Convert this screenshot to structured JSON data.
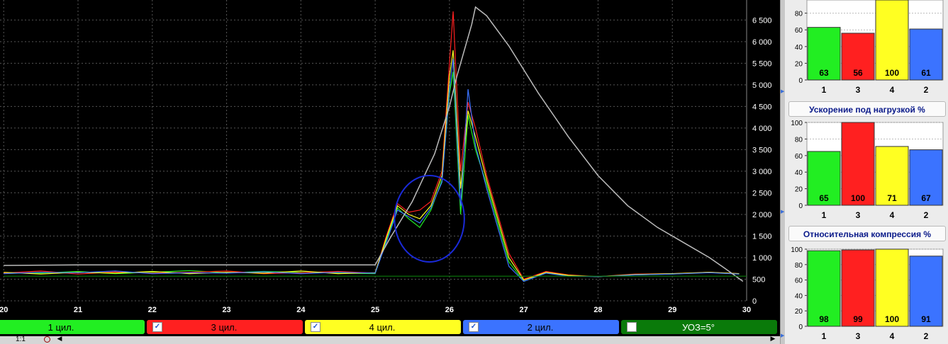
{
  "colors": {
    "background": "#000000",
    "grid": "#555555",
    "cyl1": "#22ee22",
    "cyl3": "#ff2020",
    "cyl4": "#ffff22",
    "cyl2": "#3b73ff",
    "rpm": "#bbbbbb",
    "uoz": "#0a7a0a",
    "annotation": "#1a2ad8"
  },
  "legend": [
    {
      "label": "1 цил.",
      "checked": true,
      "color": "#22ee22"
    },
    {
      "label": "3 цил.",
      "checked": true,
      "color": "#ff2020"
    },
    {
      "label": "4 цил.",
      "checked": true,
      "color": "#ffff22"
    },
    {
      "label": "2 цил.",
      "checked": true,
      "color": "#3b73ff"
    },
    {
      "label": "УОЗ=5°",
      "checked": false,
      "color": "#0a7a0a"
    }
  ],
  "status_bar": {
    "scale": "1:1"
  },
  "chart_data": [
    {
      "type": "line",
      "x_ticks": [
        "20",
        "21",
        "22",
        "23",
        "24",
        "25",
        "26",
        "27",
        "28",
        "29",
        "30"
      ],
      "y_ticks": [
        "0",
        "500",
        "1 000",
        "1 500",
        "2 000",
        "2 500",
        "3 000",
        "3 500",
        "4 000",
        "4 500",
        "5 000",
        "5 500",
        "6 000",
        "6 500"
      ],
      "xlim": [
        19.95,
        30.0
      ],
      "ylim": [
        0,
        6800
      ],
      "grid": true,
      "series": [
        {
          "name": "1 цил.",
          "color": "#22ee22",
          "x": [
            20,
            20.5,
            21,
            21.5,
            22,
            22.5,
            23,
            23.5,
            24,
            24.5,
            25,
            25.15,
            25.3,
            25.45,
            25.6,
            25.75,
            25.9,
            26.0,
            26.05,
            26.15,
            26.25,
            26.35,
            26.5,
            26.65,
            26.8,
            27.0,
            27.3,
            27.6,
            28,
            28.5,
            29,
            29.5,
            29.9
          ],
          "y": [
            650,
            640,
            680,
            630,
            660,
            700,
            650,
            680,
            660,
            640,
            630,
            1400,
            2150,
            1900,
            1700,
            2100,
            2800,
            4800,
            5300,
            2000,
            4300,
            3500,
            2700,
            1800,
            900,
            450,
            650,
            580,
            560,
            600,
            620,
            660,
            620
          ]
        },
        {
          "name": "3 цил.",
          "color": "#ff2020",
          "x": [
            20,
            20.5,
            21,
            21.5,
            22,
            22.5,
            23,
            23.5,
            24,
            24.5,
            25,
            25.15,
            25.3,
            25.45,
            25.6,
            25.75,
            25.9,
            26.0,
            26.05,
            26.15,
            26.25,
            26.35,
            26.5,
            26.65,
            26.8,
            27.0,
            27.3,
            27.6,
            28,
            28.5,
            29,
            29.5,
            29.9
          ],
          "y": [
            640,
            690,
            620,
            670,
            640,
            660,
            690,
            630,
            650,
            680,
            640,
            1500,
            2250,
            2050,
            2100,
            2300,
            3000,
            5500,
            6700,
            3000,
            4600,
            4000,
            2900,
            2000,
            1100,
            500,
            680,
            600,
            560,
            620,
            630,
            660,
            630
          ]
        },
        {
          "name": "4 цил.",
          "color": "#ffff22",
          "x": [
            20,
            20.5,
            21,
            21.5,
            22,
            22.5,
            23,
            23.5,
            24,
            24.5,
            25,
            25.15,
            25.3,
            25.45,
            25.6,
            25.75,
            25.9,
            26.0,
            26.05,
            26.15,
            26.25,
            26.35,
            26.5,
            26.65,
            26.8,
            27.0,
            27.3,
            27.6,
            28,
            28.5,
            29,
            29.5,
            29.9
          ],
          "y": [
            660,
            620,
            660,
            640,
            680,
            630,
            660,
            640,
            690,
            630,
            650,
            1450,
            2200,
            2000,
            1900,
            2200,
            2900,
            5200,
            5800,
            2600,
            4400,
            3800,
            2800,
            1900,
            1000,
            480,
            660,
            590,
            560,
            610,
            630,
            660,
            630
          ]
        },
        {
          "name": "2 цил.",
          "color": "#3b73ff",
          "x": [
            20,
            20.5,
            21,
            21.5,
            22,
            22.5,
            23,
            23.5,
            24,
            24.5,
            25,
            25.15,
            25.3,
            25.45,
            25.6,
            25.75,
            25.9,
            26.0,
            26.05,
            26.15,
            26.25,
            26.35,
            26.5,
            26.65,
            26.8,
            27.0,
            27.3,
            27.6,
            28,
            28.5,
            29,
            29.5,
            29.9
          ],
          "y": [
            630,
            660,
            650,
            690,
            630,
            650,
            640,
            670,
            630,
            660,
            640,
            1350,
            2100,
            1950,
            1800,
            2150,
            2750,
            4900,
            5600,
            2200,
            4900,
            3600,
            2600,
            1700,
            800,
            450,
            640,
            570,
            560,
            600,
            620,
            650,
            620
          ]
        },
        {
          "name": "rpm",
          "color": "#bbbbbb",
          "x": [
            20,
            21,
            22,
            23,
            24,
            25,
            25.2,
            25.5,
            25.8,
            26.0,
            26.1,
            26.3,
            26.35,
            26.5,
            26.8,
            27.2,
            27.6,
            28.0,
            28.4,
            28.8,
            29.2,
            29.5,
            29.7,
            29.95
          ],
          "y": [
            820,
            830,
            830,
            830,
            830,
            830,
            1450,
            2300,
            3400,
            4500,
            5200,
            6400,
            6800,
            6600,
            5900,
            4800,
            3800,
            2900,
            2200,
            1700,
            1300,
            1000,
            760,
            450
          ]
        },
        {
          "name": "uoz",
          "color": "#0a7a0a",
          "x": [
            20,
            30
          ],
          "y": [
            570,
            570
          ]
        }
      ],
      "annotation": {
        "type": "circle",
        "cx": 25.73,
        "cy": 1900,
        "rx": 0.47,
        "ry": 1000
      }
    },
    {
      "type": "bar",
      "title": "",
      "categories": [
        "1",
        "3",
        "4",
        "2"
      ],
      "values": [
        63,
        56,
        100,
        61
      ],
      "colors": [
        "#22ee22",
        "#ff2020",
        "#ffff22",
        "#3b73ff"
      ],
      "ylim": [
        0,
        100
      ],
      "y_ticks": [
        "0",
        "20",
        "40",
        "60",
        "80"
      ]
    },
    {
      "type": "bar",
      "title": "Ускорение под нагрузкой %",
      "categories": [
        "1",
        "3",
        "4",
        "2"
      ],
      "values": [
        65,
        100,
        71,
        67
      ],
      "colors": [
        "#22ee22",
        "#ff2020",
        "#ffff22",
        "#3b73ff"
      ],
      "ylim": [
        0,
        100
      ],
      "y_ticks": [
        "0",
        "20",
        "40",
        "60",
        "80",
        "100"
      ]
    },
    {
      "type": "bar",
      "title": "Относительная компрессия %",
      "categories": [
        "1",
        "3",
        "4",
        "2"
      ],
      "values": [
        98,
        99,
        100,
        91
      ],
      "colors": [
        "#22ee22",
        "#ff2020",
        "#ffff22",
        "#3b73ff"
      ],
      "ylim": [
        0,
        100
      ],
      "y_ticks": [
        "0",
        "20",
        "40",
        "60",
        "80",
        "100"
      ]
    }
  ]
}
